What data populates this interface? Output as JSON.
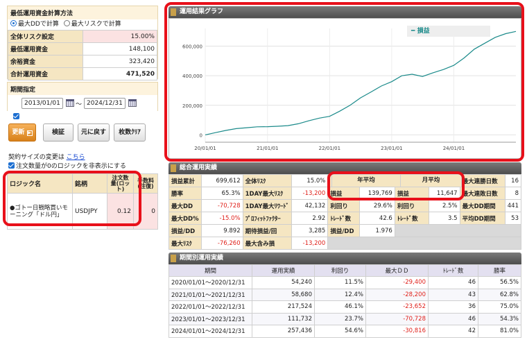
{
  "calc": {
    "title": "最低運用資金計算方法",
    "opt_dd": "最大DDで計算",
    "opt_risk": "最大リスクで計算",
    "rows": [
      {
        "label": "全体リスク設定",
        "value": "15.00%"
      },
      {
        "label": "最低運用資金",
        "value": "148,100"
      },
      {
        "label": "余裕資金",
        "value": "323,420"
      },
      {
        "label": "合計運用資金",
        "value": "471,520"
      }
    ]
  },
  "period": {
    "title": "期間指定",
    "start": "2013/01/01",
    "sep": "～",
    "end": "2024/12/31"
  },
  "buttons": {
    "update": "更新",
    "verify": "検証",
    "reset": "元に戻す",
    "clear": "枚数ｸﾘｱ"
  },
  "contract": {
    "note": "契約サイズの変更は",
    "link": "こちら",
    "hide_label": "注文数量が0のロジックを非表示にする"
  },
  "logic_table": {
    "headers": [
      "ロジック名",
      "銘柄",
      "注文数量(ロット)",
      "手数料(往復)"
    ],
    "rows": [
      {
        "name": "●ゴトー日戦略買いモーニング「ドル円」",
        "symbol": "USDJPY",
        "qty": "0.12",
        "fee": "0"
      }
    ]
  },
  "graph": {
    "title": "運用結果グラフ",
    "legend": "損益"
  },
  "chart_data": {
    "type": "line",
    "title": "運用結果グラフ",
    "series": [
      {
        "name": "損益",
        "x": [
          "2020/01/01",
          "2020/03/01",
          "2020/05/01",
          "2020/07/01",
          "2020/09/01",
          "2020/11/01",
          "2021/01/01",
          "2021/03/01",
          "2021/05/01",
          "2021/07/01",
          "2021/09/01",
          "2021/11/01",
          "2022/01/01",
          "2022/03/01",
          "2022/05/01",
          "2022/07/01",
          "2022/09/01",
          "2022/11/01",
          "2023/01/01",
          "2023/03/01",
          "2023/05/01",
          "2023/07/01",
          "2023/09/01",
          "2023/11/01",
          "2024/01/01",
          "2024/03/01",
          "2024/05/01",
          "2024/07/01",
          "2024/09/01",
          "2024/11/01",
          "2024/12/31"
        ],
        "values": [
          0,
          15000,
          30000,
          42000,
          48000,
          54240,
          55000,
          58000,
          62000,
          75000,
          95000,
          112920,
          125000,
          160000,
          200000,
          250000,
          290000,
          330444,
          360000,
          400000,
          410000,
          395000,
          420000,
          442176,
          470000,
          520000,
          580000,
          620000,
          660000,
          685000,
          699612
        ]
      }
    ],
    "x_ticks": [
      "20/01/01",
      "21/01/01",
      "22/01/01",
      "23/01/01",
      "24/01/01"
    ],
    "y_ticks": [
      "0",
      "200,000",
      "400,000",
      "600,000"
    ],
    "ylim": [
      -50000,
      720000
    ],
    "grid": true,
    "legend_position": "top-right",
    "line_color": "#1a8a8a"
  },
  "stats": {
    "title": "総合運用実績",
    "rows": [
      [
        {
          "l": "損益累計",
          "v": "699,612"
        },
        {
          "l": "全体ﾘｽｸ",
          "v": "15.0%"
        },
        {
          "l": "",
          "v": ""
        },
        {
          "l": "最大連勝日数",
          "v": "16"
        }
      ],
      [
        {
          "l": "勝率",
          "v": "65.3%"
        },
        {
          "l": "1DAY最大ﾘｽｸ",
          "v": "-13,200"
        },
        {
          "l": "",
          "v": ""
        },
        {
          "l": "最大連敗日数",
          "v": "8"
        }
      ],
      [
        {
          "l": "最大DD",
          "v": "-70,728"
        },
        {
          "l": "1DAY最大ﾘﾜｰﾄﾞ",
          "v": "42,132"
        },
        {
          "l": "利回り",
          "v": "29.6%"
        },
        {
          "l": "最大DD期間",
          "v": "441"
        }
      ],
      [
        {
          "l": "最大DD%",
          "v": "-15.0%"
        },
        {
          "l": "ﾌﾟﾛﾌｨｯﾄﾌｧｸﾀｰ",
          "v": "2.92"
        },
        {
          "l": "ﾄﾚｰﾄﾞ数",
          "v": "42.6"
        },
        {
          "l": "平均DD期間",
          "v": "53"
        }
      ],
      [
        {
          "l": "損益/DD",
          "v": "9.892"
        },
        {
          "l": "期待損益/回",
          "v": "3,285"
        },
        {
          "l": "損益/DD",
          "v": "1.976"
        },
        {
          "l": "",
          "v": ""
        }
      ],
      [
        {
          "l": "最大ﾘｽｸ",
          "v": "-76,260"
        },
        {
          "l": "最大含み損",
          "v": "-13,200"
        },
        {
          "l": "",
          "v": ""
        },
        {
          "l": "",
          "v": ""
        }
      ]
    ],
    "annual_title": "年平均",
    "monthly_title": "月平均",
    "annual_label": "損益",
    "annual_value": "139,769",
    "monthly_label": "損益",
    "monthly_value": "11,647",
    "monthly_yield_label": "利回り",
    "monthly_yield": "2.5%",
    "monthly_trades_label": "ﾄﾚｰﾄﾞ数",
    "monthly_trades": "3.5"
  },
  "periodic": {
    "title": "期間別運用実績",
    "headers": [
      "期間",
      "運用実績",
      "利回り",
      "最大ＤＤ",
      "ﾄﾚｰﾄﾞ数",
      "勝率"
    ],
    "rows": [
      [
        "2020/01/01～2020/12/31",
        "54,240",
        "11.5%",
        "-29,400",
        "46",
        "56.5%"
      ],
      [
        "2021/01/01～2021/12/31",
        "58,680",
        "12.4%",
        "-28,200",
        "43",
        "62.8%"
      ],
      [
        "2022/01/01～2022/12/31",
        "217,524",
        "46.1%",
        "-23,652",
        "36",
        "75.0%"
      ],
      [
        "2023/01/01～2023/12/31",
        "111,732",
        "23.7%",
        "-70,728",
        "46",
        "54.3%"
      ],
      [
        "2024/01/01～2024/12/31",
        "257,436",
        "54.6%",
        "-30,816",
        "42",
        "81.0%"
      ]
    ]
  }
}
